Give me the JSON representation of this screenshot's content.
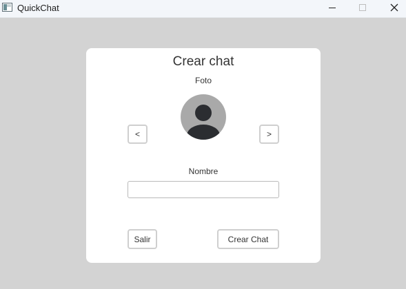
{
  "window": {
    "title": "QuickChat",
    "icon": "app-window-icon",
    "controls": [
      "minimize-icon",
      "maximize-icon",
      "close-icon"
    ]
  },
  "dialog": {
    "heading": "Crear chat",
    "photo_label": "Foto",
    "avatar_icon": "user-avatar-icon",
    "prev_label": "<",
    "next_label": ">",
    "name_label": "Nombre",
    "name_value": "",
    "exit_label": "Salir",
    "create_label": "Crear Chat"
  },
  "colors": {
    "background": "#d3d3d3",
    "card": "#ffffff",
    "avatar_bg": "#a9a9a9",
    "avatar_figure": "#2b2d31"
  }
}
